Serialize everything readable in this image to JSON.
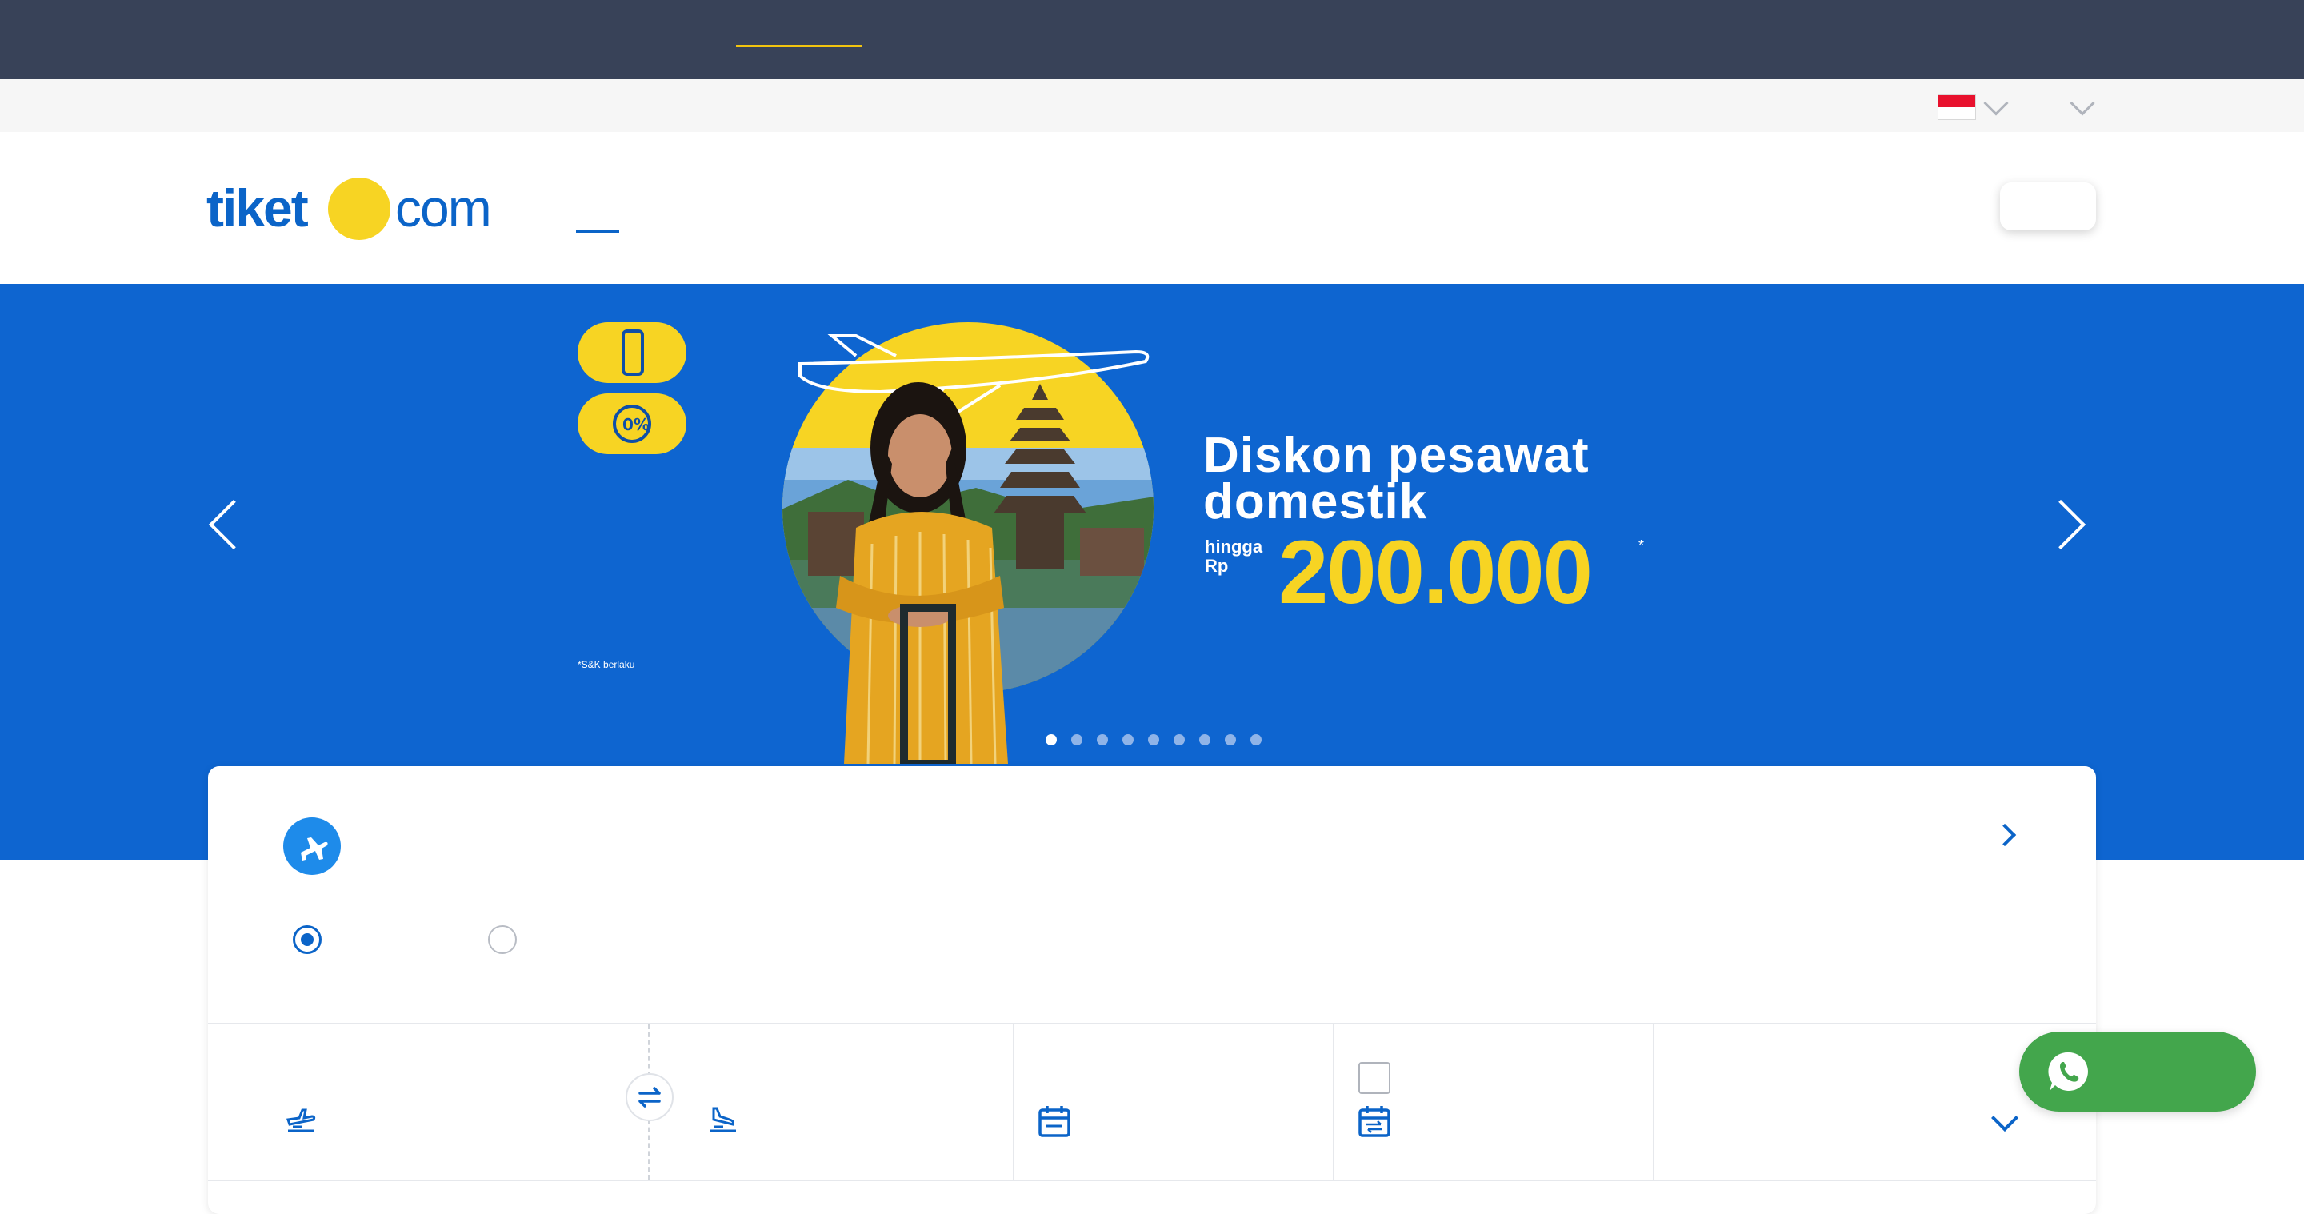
{
  "topbar": {
    "active_underline_color": "#f2c40f",
    "background": "#384258"
  },
  "utility": {
    "language_flag": "indonesia-flag-icon",
    "language_chevron": "chevron-down-icon",
    "currency_chevron": "chevron-down-icon"
  },
  "header": {
    "logo_left": "tiket",
    "logo_right": "com",
    "logo_dot_color": "#f7d423",
    "brand_color": "#0b64c8"
  },
  "banner": {
    "headline_line1": "Diskon pesawat",
    "headline_line2": "domestik",
    "prefix": "hingga Rp",
    "amount": "200.000",
    "asterisk": "*",
    "tnc": "*S&K berlaku",
    "pill_icon_1": "phone-icon",
    "pill_icon_2": "0%",
    "slide_count": 9,
    "active_slide": 1,
    "background": "#0e65d0",
    "accent": "#f7d423"
  },
  "search": {
    "product_icon": "plane-icon",
    "trip_type_selected": "one-way",
    "swap_icon": "swap-arrows-icon",
    "origin_icon": "departure-plane-icon",
    "destination_icon": "arrival-plane-icon",
    "depart_date_icon": "calendar-icon",
    "return_date_icon": "calendar-return-icon",
    "return_checkbox_checked": false,
    "passengers_chevron": "chevron-down-icon"
  },
  "whatsapp": {
    "icon": "whatsapp-icon",
    "color": "#43a64c"
  }
}
